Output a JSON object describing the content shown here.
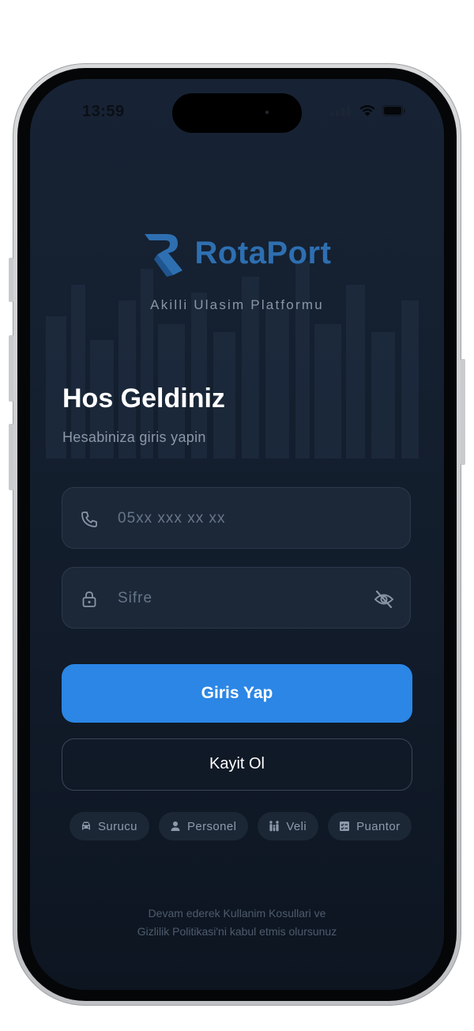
{
  "status_bar": {
    "time": "13:59"
  },
  "brand": {
    "name": "RotaPort",
    "tagline": "Akilli Ulasim Platformu",
    "color": "#2e6fb1"
  },
  "heading": {
    "title": "Hos Geldiniz",
    "subtitle": "Hesabiniza giris yapin"
  },
  "form": {
    "phone": {
      "icon": "phone-icon",
      "placeholder": "05xx xxx xx xx"
    },
    "password": {
      "icon": "lock-icon",
      "placeholder": "Sifre",
      "toggle_icon": "eye-off-icon"
    }
  },
  "actions": {
    "login_label": "Giris Yap",
    "register_label": "Kayit Ol",
    "accent": "#2b86e6"
  },
  "roles": [
    {
      "label": "Surucu",
      "icon": "car-icon"
    },
    {
      "label": "Personel",
      "icon": "person-icon"
    },
    {
      "label": "Veli",
      "icon": "family-icon"
    },
    {
      "label": "Puantor",
      "icon": "checklist-icon"
    }
  ],
  "footer": {
    "line1": "Devam ederek Kullanim Kosullari ve",
    "line2": "Gizlilik Politikasi'ni kabul etmis olursunuz"
  }
}
